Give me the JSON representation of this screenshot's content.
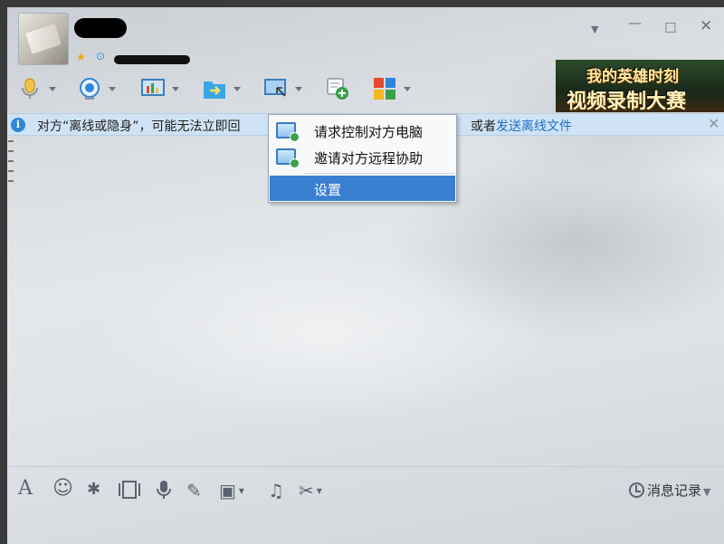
{
  "window": {
    "controls": {
      "dropdown": "▼",
      "minimize": "—",
      "maximize": "☐",
      "close": "✕"
    }
  },
  "toolbar": {
    "tools": [
      {
        "name": "voice-call",
        "icon": "microphone-icon",
        "color": "#e0a020"
      },
      {
        "name": "video-call",
        "icon": "webcam-icon",
        "color": "#2f86d8"
      },
      {
        "name": "screen-share",
        "icon": "screen-share-icon",
        "color": "#2f86d8"
      },
      {
        "name": "send-file",
        "icon": "folder-transfer-icon",
        "color": "#2f9bdc"
      },
      {
        "name": "remote-desktop",
        "icon": "remote-desktop-icon",
        "color": "#3c7cc0"
      },
      {
        "name": "create-group-chat",
        "icon": "chat-add-icon",
        "color": "#3aa04a"
      },
      {
        "name": "apps",
        "icon": "apps-grid-icon",
        "color": "#e6492d"
      }
    ]
  },
  "ad": {
    "line1": "我的英雄时刻",
    "line2": "视频录制大赛"
  },
  "infobar": {
    "text_before": "对方“离线或隐身”，可能无法立即回",
    "text_after": "或者",
    "link": "发送离线文件",
    "close": "✕"
  },
  "remote_menu": {
    "items": [
      {
        "label": "请求控制对方电脑",
        "icon": "remote-control-icon"
      },
      {
        "label": "邀请对方远程协助",
        "icon": "remote-assist-icon"
      },
      {
        "label": "设置",
        "selected": true
      }
    ]
  },
  "bottom_toolbar": {
    "tools": [
      {
        "name": "font",
        "glyph": "A"
      },
      {
        "name": "emoji",
        "glyph": "☺"
      },
      {
        "name": "window-shake",
        "glyph": "✱"
      },
      {
        "name": "voice-message",
        "glyph": "🎙"
      },
      {
        "name": "handwriting",
        "glyph": "✎"
      },
      {
        "name": "image",
        "glyph": "▣"
      },
      {
        "name": "music",
        "glyph": "♫"
      },
      {
        "name": "screenshot",
        "glyph": "✂"
      }
    ],
    "history_label": "消息记录"
  },
  "colors": {
    "accent": "#3a7fd0",
    "link": "#1e6fc8",
    "info_bg": "#cfe3f4"
  }
}
